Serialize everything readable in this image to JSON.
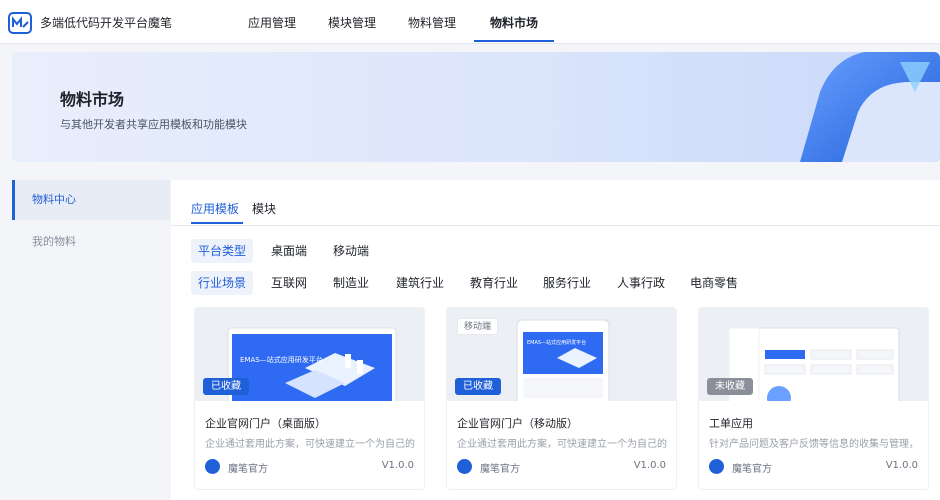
{
  "app": {
    "title": "多端低代码开发平台魔笔"
  },
  "nav": [
    {
      "label": "应用管理"
    },
    {
      "label": "模块管理"
    },
    {
      "label": "物料管理"
    },
    {
      "label": "物料市场"
    }
  ],
  "banner": {
    "title": "物料市场",
    "subtitle": "与其他开发者共享应用模板和功能模块"
  },
  "sidebar": [
    {
      "label": "物料中心",
      "active": true
    },
    {
      "label": "我的物料",
      "active": false
    }
  ],
  "tabs": [
    {
      "label": "应用模板",
      "active": true
    },
    {
      "label": "模块",
      "active": false
    }
  ],
  "platform_filter": [
    "平台类型",
    "桌面端",
    "移动端"
  ],
  "industry_filter": [
    "行业场景",
    "互联网",
    "制造业",
    "建筑行业",
    "教育行业",
    "服务行业",
    "人事行政",
    "电商零售"
  ],
  "cards": [
    {
      "title": "企业官网门户（桌面版）",
      "description": "企业通过套用此方案，可快速建立一个为自己的",
      "badge": "已收藏",
      "tag": "",
      "author": "魔笔官方",
      "version": "V1.0.0",
      "preview_text": "EMAS—站式应用研发平台"
    },
    {
      "title": "企业官网门户（移动版）",
      "description": "企业通过套用此方案，可快速建立一个为自己的",
      "badge": "已收藏",
      "tag": "移动端",
      "author": "魔笔官方",
      "version": "V1.0.0",
      "preview_text": "EMAS—站式应用研发平台"
    },
    {
      "title": "工单应用",
      "description": "针对产品问题及客户反馈等信息的收集与管理，",
      "badge": "未收藏",
      "tag": "",
      "author": "魔笔官方",
      "version": "V1.0.0",
      "preview_text": ""
    }
  ],
  "colors": {
    "accent": "#1f5fd8",
    "badge_uncollected": "#8a8f99"
  }
}
